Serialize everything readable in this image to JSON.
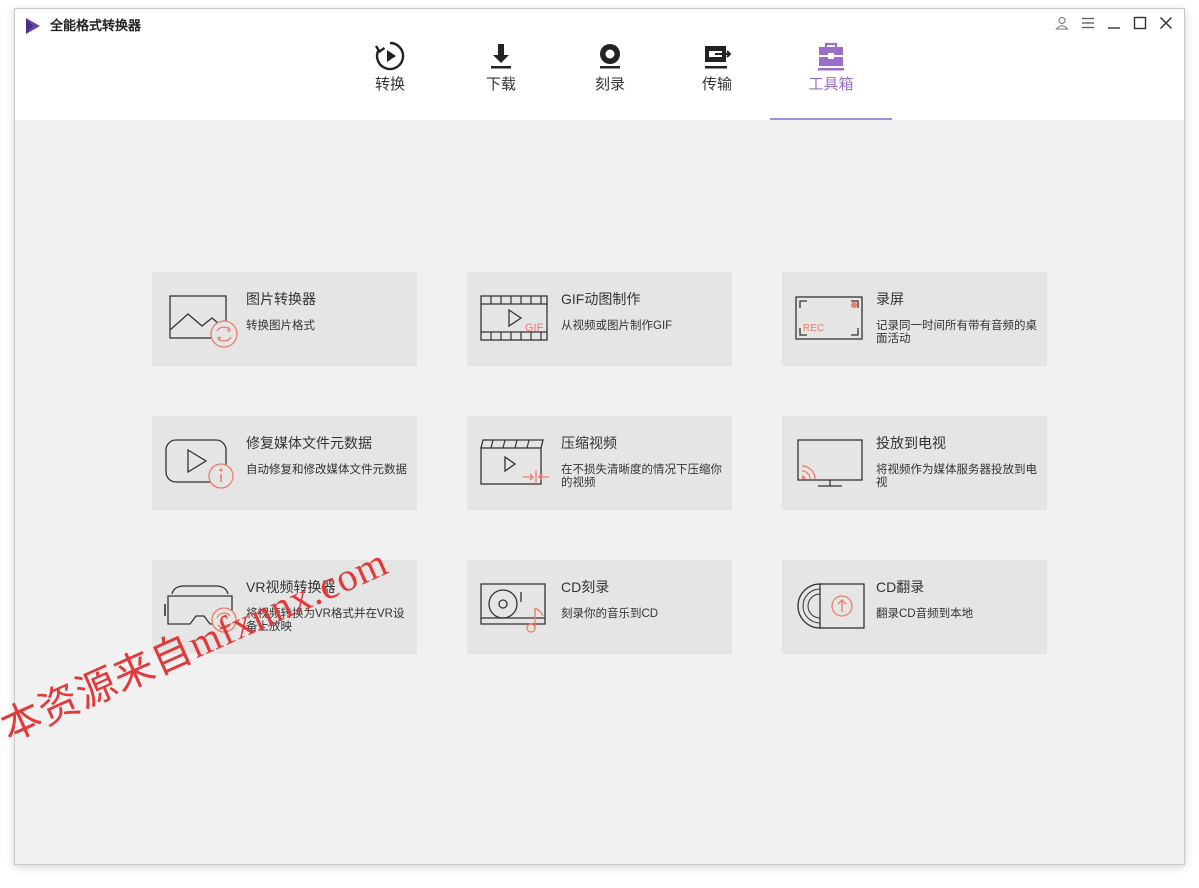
{
  "app": {
    "title": "全能格式转换器"
  },
  "nav": {
    "tabs": [
      {
        "label": "转换"
      },
      {
        "label": "下载"
      },
      {
        "label": "刻录"
      },
      {
        "label": "传输"
      },
      {
        "label": "工具箱"
      }
    ],
    "active": "工具箱"
  },
  "tools": [
    {
      "title": "图片转换器",
      "desc": "转换图片格式"
    },
    {
      "title": "GIF动图制作",
      "desc": "从视频或图片制作GIF"
    },
    {
      "title": "录屏",
      "desc": "记录同一时间所有带有音频的桌面活动"
    },
    {
      "title": "修复媒体文件元数据",
      "desc": "自动修复和修改媒体文件元数据"
    },
    {
      "title": "压缩视频",
      "desc": "在不损失清晰度的情况下压缩你的视频"
    },
    {
      "title": "投放到电视",
      "desc": "将视频作为媒体服务器投放到电视"
    },
    {
      "title": "VR视频转换器",
      "desc": "将视频转换为VR格式并在VR设备上放映"
    },
    {
      "title": "CD刻录",
      "desc": "刻录你的音乐到CD"
    },
    {
      "title": "CD翻录",
      "desc": "翻录CD音频到本地"
    }
  ],
  "watermark": "本资源来自mfxnnx.com",
  "colors": {
    "accent": "#9a6fc8",
    "icon_accent": "#ee7b6a",
    "card_bg": "#e5e5e5",
    "content_bg": "#f1f1f1"
  }
}
